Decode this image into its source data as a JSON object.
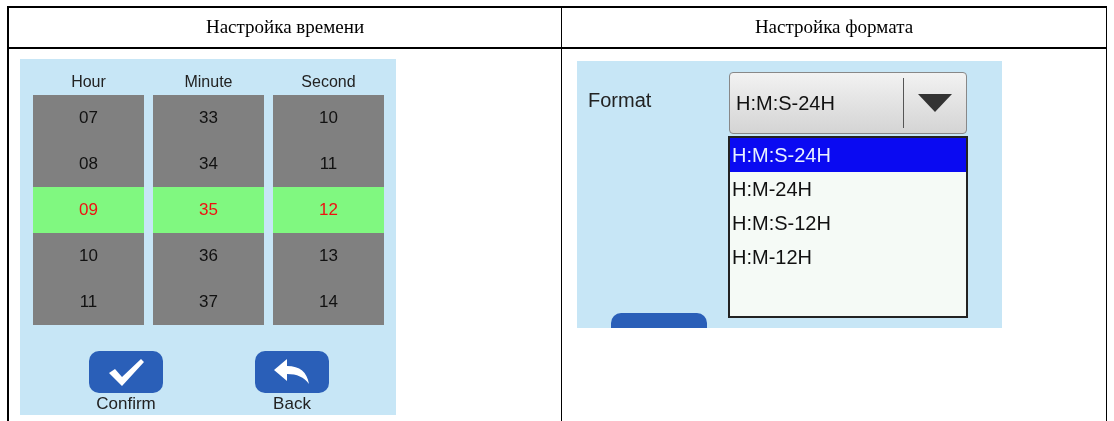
{
  "table": {
    "headers": [
      "Настройка времени",
      "Настройка формата"
    ]
  },
  "time_screen": {
    "columns": [
      {
        "label": "Hour",
        "items": [
          {
            "text": "07",
            "selected": false
          },
          {
            "text": "08",
            "selected": false
          },
          {
            "text": "09",
            "selected": true
          },
          {
            "text": "10",
            "selected": false
          },
          {
            "text": "11",
            "selected": false
          }
        ]
      },
      {
        "label": "Minute",
        "items": [
          {
            "text": "33",
            "selected": false
          },
          {
            "text": "34",
            "selected": false
          },
          {
            "text": "35",
            "selected": true
          },
          {
            "text": "36",
            "selected": false
          },
          {
            "text": "37",
            "selected": false
          }
        ]
      },
      {
        "label": "Second",
        "items": [
          {
            "text": "10",
            "selected": false
          },
          {
            "text": "11",
            "selected": false
          },
          {
            "text": "12",
            "selected": true
          },
          {
            "text": "13",
            "selected": false
          },
          {
            "text": "14",
            "selected": false
          }
        ]
      }
    ],
    "buttons": [
      {
        "kind": "confirm",
        "label": "Confirm"
      },
      {
        "kind": "back",
        "label": "Back"
      }
    ]
  },
  "format_screen": {
    "label": "Format",
    "dropdown": {
      "value": "H:M:S-24H",
      "expanded": true,
      "options": [
        {
          "text": "H:M:S-24H",
          "selected": true
        },
        {
          "text": "H:M-24H",
          "selected": false
        },
        {
          "text": "H:M:S-12H",
          "selected": false
        },
        {
          "text": "H:M-12H",
          "selected": false
        }
      ]
    }
  }
}
